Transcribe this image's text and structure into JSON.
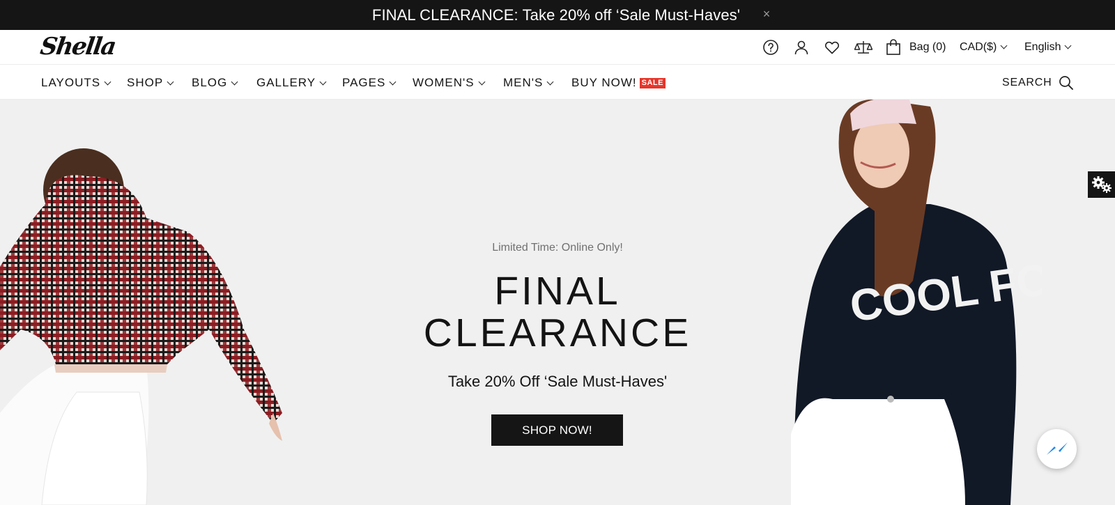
{
  "announcement": {
    "text": "FINAL CLEARANCE: Take 20% off ‘Sale Must-Haves'",
    "close_label": "×"
  },
  "header": {
    "logo": "Shella",
    "icons": [
      "help-icon",
      "account-icon",
      "wishlist-icon",
      "compare-icon",
      "bag-icon"
    ],
    "bag_label": "Bag (0)",
    "currency": "CAD($)",
    "language": "English"
  },
  "nav": {
    "items": [
      {
        "label": "LAYOUTS"
      },
      {
        "label": "SHOP"
      },
      {
        "label": "BLOG"
      },
      {
        "label": "GALLERY"
      },
      {
        "label": "PAGES"
      },
      {
        "label": "WOMEN'S"
      },
      {
        "label": "MEN'S"
      },
      {
        "label": "BUY NOW!"
      }
    ],
    "sale_badge": "SALE",
    "search_label": "SEARCH"
  },
  "hero": {
    "subtitle": "Limited Time: Online Only!",
    "title_line1": "FINAL",
    "title_line2": "CLEARANCE",
    "offer": "Take 20% Off ‘Sale Must-Haves'",
    "button": "SHOP NOW!"
  },
  "colors": {
    "dark": "#151515",
    "sale": "#e73529",
    "hero_bg": "#f0f0f0",
    "messenger": "#1e88f0"
  }
}
